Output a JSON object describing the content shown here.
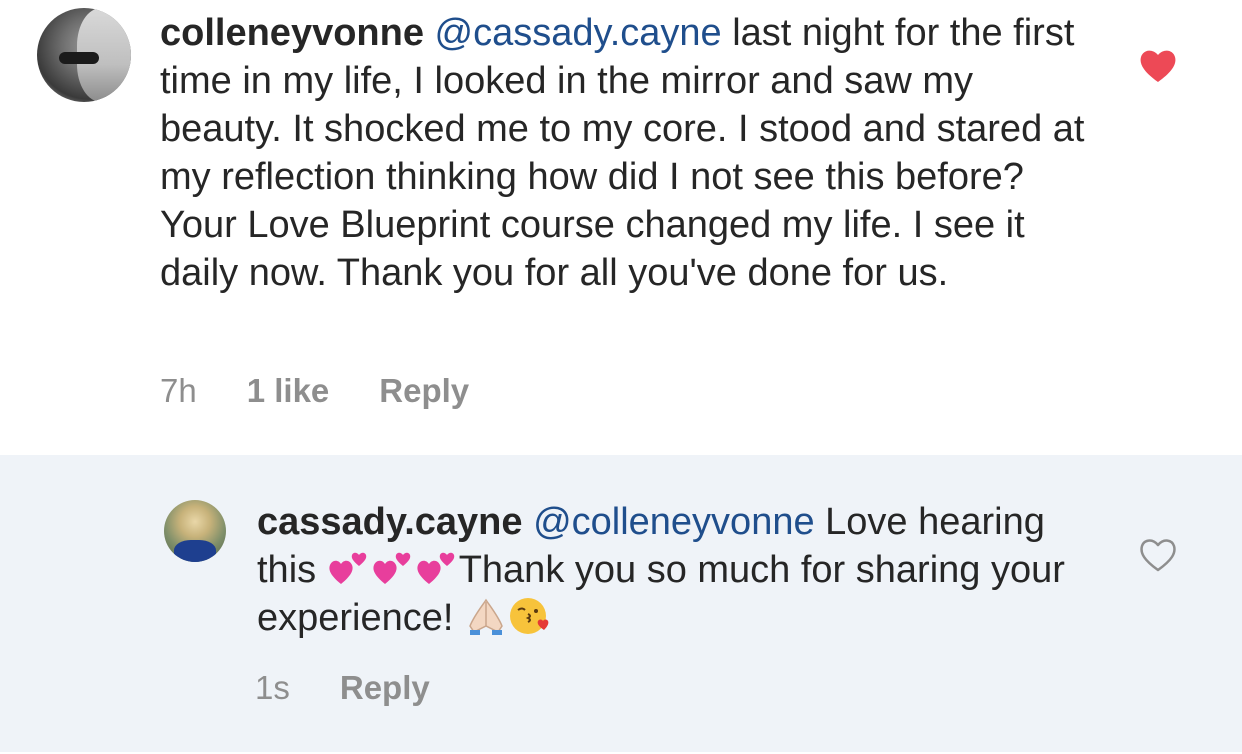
{
  "comment": {
    "username": "colleneyvonne",
    "mention": "@cassady.cayne",
    "text": " last night for the first time in my life, I looked in the mirror and saw my beauty. It shocked me to my core. I stood and stared at my reflection thinking how did I not see this before? Your Love Blueprint course changed my life. I see it daily now. Thank you for all you've done for us.",
    "time": "7h",
    "likes": "1 like",
    "reply_label": "Reply",
    "liked": true,
    "heart_color": "#ed4956"
  },
  "reply": {
    "username": "cassady.cayne",
    "mention": "@colleneyvonne",
    "text_part1": " Love hearing this ",
    "text_part2": "Thank you so much for sharing your experience! ",
    "emojis_hearts": [
      "two-hearts-emoji",
      "two-hearts-emoji",
      "two-hearts-emoji"
    ],
    "emojis_end": [
      "folded-hands-emoji",
      "kissing-face-emoji"
    ],
    "time": "1s",
    "reply_label": "Reply",
    "liked": false,
    "heart_color": "#8e8e8e"
  },
  "colors": {
    "mention": "#1f4e8c",
    "meta": "#8e8e8e",
    "reply_background": "#eff3f8"
  }
}
